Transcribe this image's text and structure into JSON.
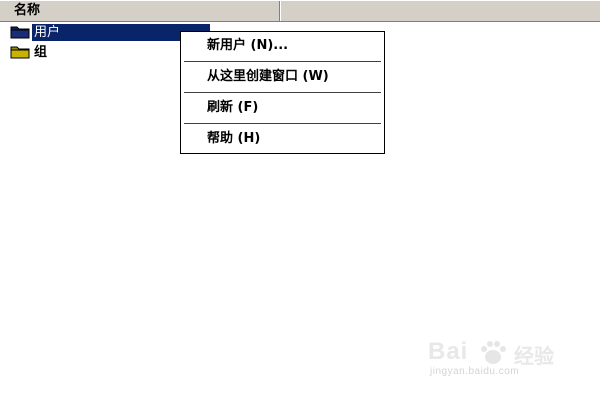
{
  "header": {
    "column_name": "名称"
  },
  "list": {
    "items": [
      {
        "label": "用户",
        "icon": "folder-icon",
        "selected": true
      },
      {
        "label": "组",
        "icon": "folder-icon",
        "selected": false
      }
    ]
  },
  "context_menu": {
    "items": [
      {
        "label": "新用户 (N)..."
      },
      {
        "label": "从这里创建窗口 (W)"
      },
      {
        "label": "刷新 (F)"
      },
      {
        "label": "帮助 (H)"
      }
    ]
  },
  "watermark": {
    "logo": "Bai",
    "suffix": "经验",
    "url": "jingyan.baidu.com"
  },
  "colors": {
    "selection": "#0a246a",
    "header_bg": "#d4d0c8",
    "folder_yellow": "#c8b400"
  }
}
